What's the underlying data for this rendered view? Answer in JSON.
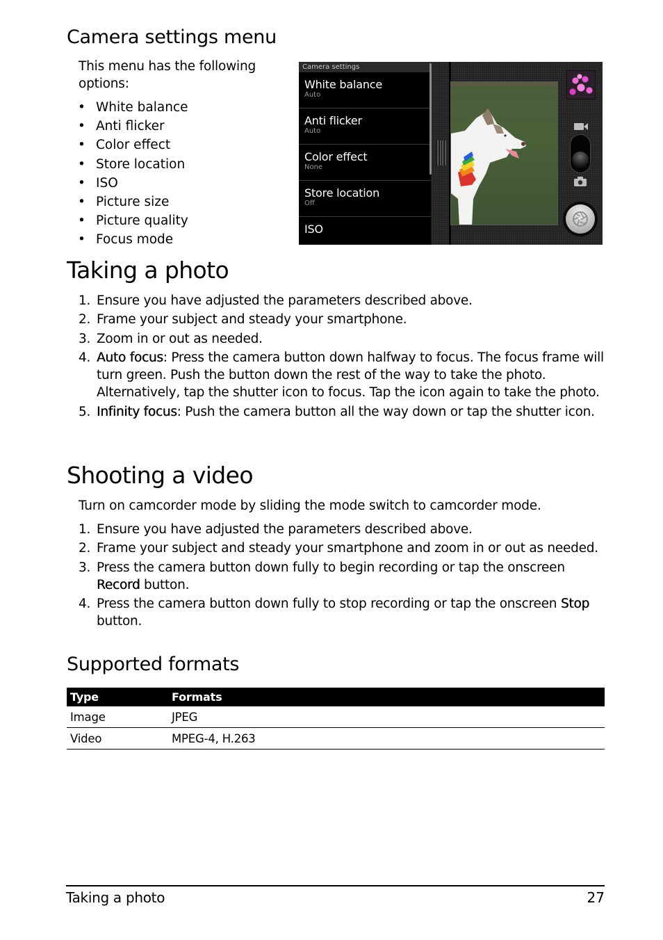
{
  "camera_settings_section": {
    "heading": "Camera settings menu",
    "intro": "This menu has the following options:",
    "options": [
      "White balance",
      "Anti flicker",
      "Color effect",
      "Store location",
      "ISO",
      "Picture size",
      "Picture quality",
      "Focus mode"
    ]
  },
  "screenshot": {
    "menu_title": "Camera settings",
    "menu_items": [
      {
        "label": "White balance",
        "value": "Auto"
      },
      {
        "label": "Anti flicker",
        "value": "Auto"
      },
      {
        "label": "Color effect",
        "value": "None"
      },
      {
        "label": "Store location",
        "value": "Off"
      },
      {
        "label": "ISO",
        "value": ""
      }
    ],
    "icons": {
      "video_mode": "video-camera-icon",
      "photo_mode": "camera-icon",
      "shutter": "shutter-aperture-icon",
      "gallery_thumbnail": "gallery-thumbnail"
    },
    "mode_switch_position": "photo"
  },
  "taking_photo_section": {
    "heading": "Taking a photo",
    "steps": [
      {
        "num": "1.",
        "term": "",
        "text": "Ensure you have adjusted the parameters described above."
      },
      {
        "num": "2.",
        "term": "",
        "text": "Frame your subject and steady your smartphone."
      },
      {
        "num": "3.",
        "term": "",
        "text": "Zoom in or out as needed."
      },
      {
        "num": "4.",
        "term": "Auto focus",
        "text": ": Press the camera button down halfway to focus. The focus frame will turn green. Push the button down the rest of the way to take the photo. Alternatively, tap the shutter icon to focus. Tap the icon again to take the photo."
      },
      {
        "num": "5.",
        "term": "Infinity focus",
        "text": ": Push the camera button all the way down or tap the shutter icon."
      }
    ]
  },
  "shooting_video_section": {
    "heading": "Shooting a video",
    "intro": "Turn on camcorder mode by sliding the mode switch to camcorder mode.",
    "steps": [
      {
        "num": "1.",
        "pre": "Ensure you have adjusted the parameters described above.",
        "term": "",
        "post": ""
      },
      {
        "num": "2.",
        "pre": "Frame your subject and steady your smartphone and zoom in or out as needed.",
        "term": "",
        "post": ""
      },
      {
        "num": "3.",
        "pre": "Press the camera button down fully to begin recording or tap the onscreen ",
        "term": "Record",
        "post": " button."
      },
      {
        "num": "4.",
        "pre": "Press the camera button down fully to stop recording or tap the onscreen ",
        "term": "Stop",
        "post": " button."
      }
    ]
  },
  "supported_formats_section": {
    "heading": "Supported formats",
    "columns": [
      "Type",
      "Formats"
    ],
    "rows": [
      [
        "Image",
        "JPEG"
      ],
      [
        "Video",
        "MPEG-4, H.263"
      ]
    ]
  },
  "footer": {
    "section_title": "Taking a photo",
    "page_number": "27"
  }
}
